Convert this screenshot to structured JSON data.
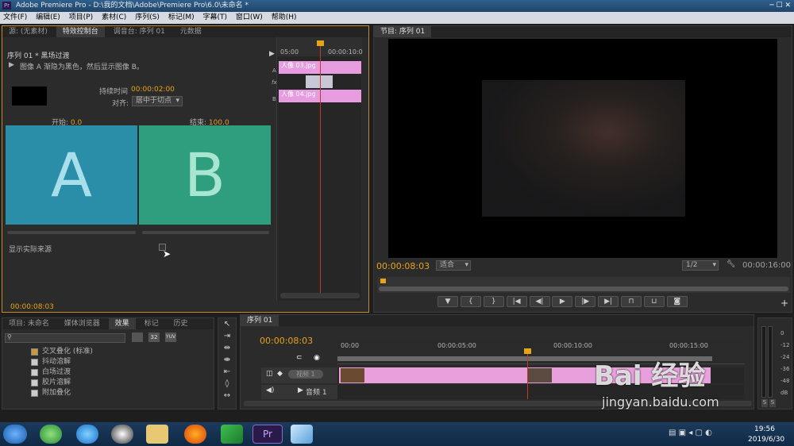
{
  "titlebar": {
    "app_icon": "Pr",
    "title": "Adobe Premiere Pro - D:\\我的文档\\Adobe\\Premiere Pro\\6.0\\未命名 *"
  },
  "menu": [
    "文件(F)",
    "编辑(E)",
    "项目(P)",
    "素材(C)",
    "序列(S)",
    "标记(M)",
    "字幕(T)",
    "窗口(W)",
    "帮助(H)"
  ],
  "source_panel": {
    "tabs": [
      "源: (无素材)",
      "特效控制台",
      "调音台: 序列 01",
      "元数据"
    ],
    "header": "序列 01 * 黑场过渡",
    "description": "图像 A 渐隐为黑色，然后显示图像 B。",
    "duration_label": "持续时间",
    "duration_value": "00:00:02:00",
    "align_label": "对齐:",
    "align_value": "居中于切点",
    "start_label": "开始:",
    "start_value": "0.0",
    "end_label": "结束:",
    "end_value": "100.0",
    "preview_a": "A",
    "preview_b": "B",
    "show_source": "显示实际来源",
    "mini_time_left": "05:00",
    "mini_time_right": "00:00:10:0",
    "mini_track_a": "A",
    "mini_track_b": "B",
    "mini_clip_a": "人像 03.jpg",
    "mini_clip_b": "人像 04.jpg",
    "footer_time": "00:00:08:03",
    "colors": {
      "tile_a": "#2b8ea8",
      "tile_b": "#2e9e7e"
    }
  },
  "program_panel": {
    "tab": "节目: 序列 01",
    "current_time": "00:00:08:03",
    "fit": "适合",
    "resolution": "1/2",
    "duration": "00:00:16:00"
  },
  "project_panel": {
    "tabs": [
      "项目: 未命名",
      "媒体浏览器",
      "效果",
      "标记",
      "历史"
    ],
    "effects": [
      "交叉叠化 (标准)",
      "抖动溶解",
      "白场过渡",
      "胶片溶解",
      "附加叠化"
    ]
  },
  "timeline": {
    "tab": "序列 01",
    "current_time": "00:00:08:03",
    "ruler": [
      "00:00",
      "00:00:05:00",
      "00:00:10:00",
      "00:00:15:00"
    ],
    "video_track": "视频 1",
    "audio_track": "音频 1"
  },
  "meter_labels": [
    "0",
    "-12",
    "-24",
    "-36",
    "-48",
    "dB"
  ],
  "meter_buttons": [
    "S",
    "S"
  ],
  "clock": {
    "time": "19:56",
    "date": "2019/6/30"
  },
  "watermark": {
    "brand": "Bai 经验",
    "url": "jingyan.baidu.com"
  }
}
